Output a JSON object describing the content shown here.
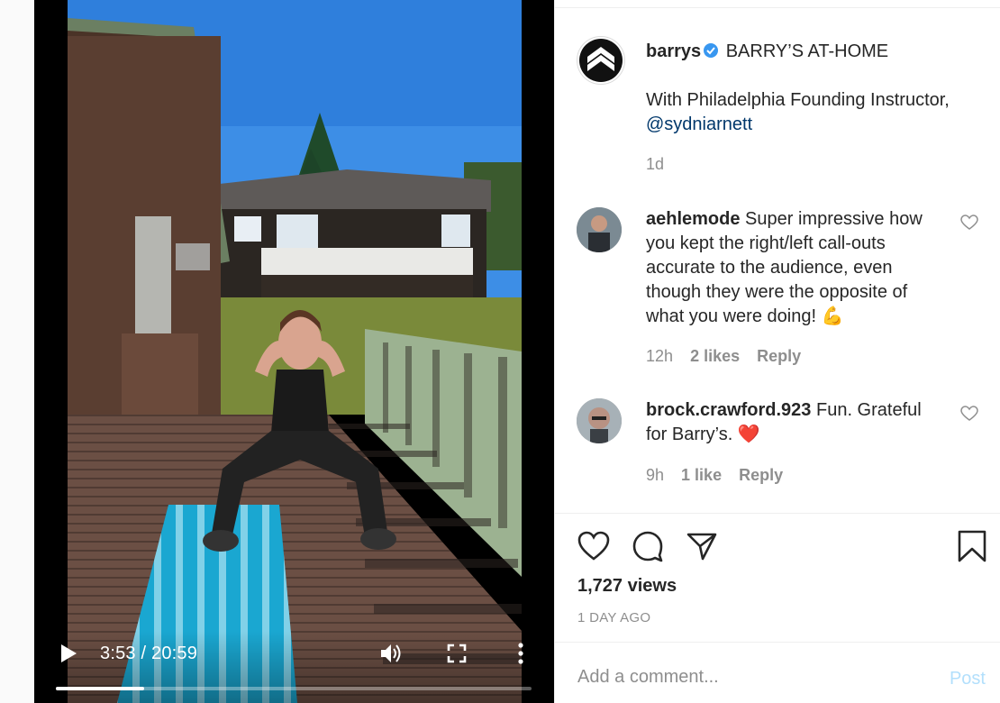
{
  "video": {
    "current_time": "3:53",
    "duration": "20:59",
    "time_display": "3:53 / 20:59",
    "progress_fraction": 0.185
  },
  "post": {
    "author": "barrys",
    "title": "BARRY’S AT-HOME",
    "caption_line": "With Philadelphia Founding Instructor,",
    "mention": "@sydniarnett",
    "age": "1d"
  },
  "comments": [
    {
      "username": "aehlemode",
      "text": "Super impressive how you kept the right/left call-outs accurate to the audience, even though they were the opposite of what you were doing!",
      "emoji": "💪",
      "age": "12h",
      "likes": "2 likes",
      "reply": "Reply"
    },
    {
      "username": "brock.crawford.923",
      "text": "Fun. Grateful for Barry’s.",
      "emoji": "❤️",
      "age": "9h",
      "likes": "1 like",
      "reply": "Reply"
    }
  ],
  "stats": {
    "views": "1,727 views",
    "posted": "1 DAY AGO"
  },
  "composer": {
    "placeholder": "Add a comment...",
    "post_label": "Post"
  },
  "colors": {
    "accent_link": "#00376b",
    "verified": "#3897f0",
    "post_disabled": "#b2dffc",
    "emoji_heart": "#ed4956"
  }
}
